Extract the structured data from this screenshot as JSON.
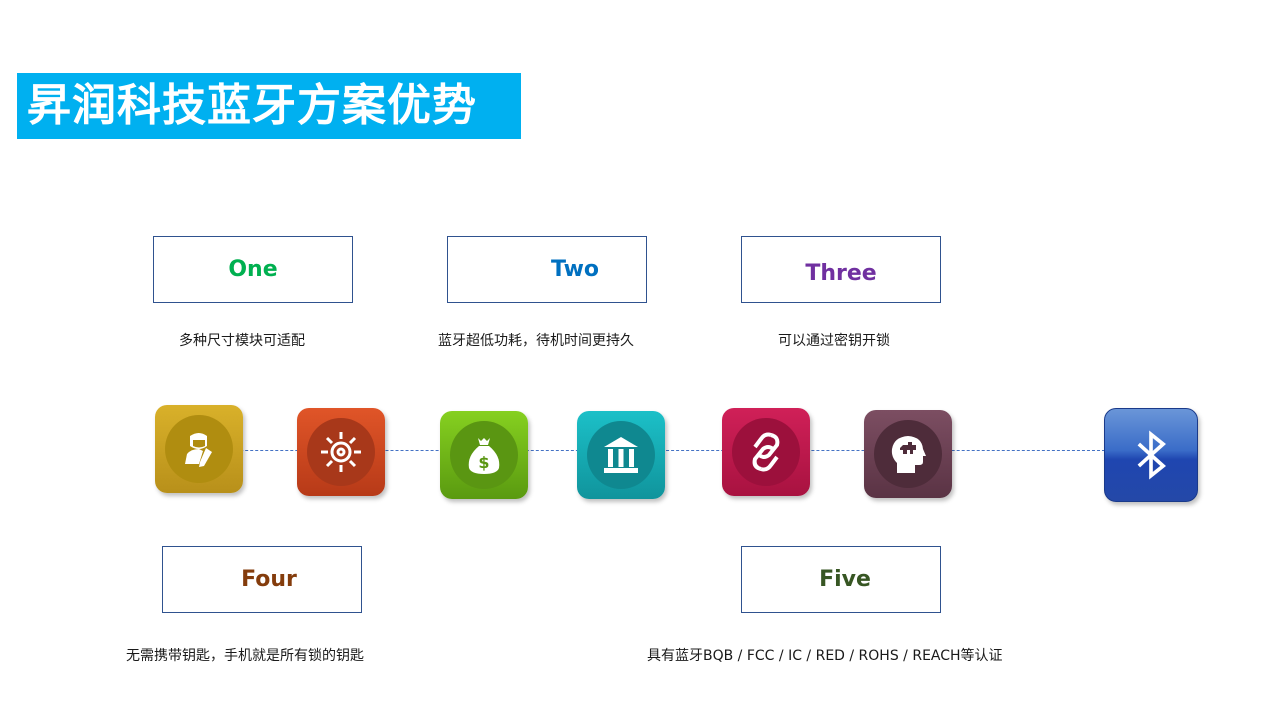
{
  "title": "昇润科技蓝牙方案优势",
  "colors": {
    "title_bg": "#00b0f0",
    "box_border": "#2f528f",
    "connector": "#4472c4"
  },
  "features": [
    {
      "label": "One",
      "color": "#00b050",
      "description": "多种尺寸模块可适配"
    },
    {
      "label": "Two",
      "color": "#0070c0",
      "description": "蓝牙超低功耗，待机时间更持久"
    },
    {
      "label": "Three",
      "color": "#7030a0",
      "description": "可以通过密钥开锁"
    },
    {
      "label": "Four",
      "color": "#843c0c",
      "description": "无需携带钥匙，手机就是所有锁的钥匙"
    },
    {
      "label": "Five",
      "color": "#375623",
      "description": "具有蓝牙BQB / FCC / IC / RED / ROHS / REACH等认证"
    }
  ],
  "icons": [
    {
      "name": "person-edit-icon",
      "color": "#c9a11a"
    },
    {
      "name": "ship-wheel-icon",
      "color": "#d04a20"
    },
    {
      "name": "money-bag-icon",
      "color": "#6eb51a"
    },
    {
      "name": "bank-icon",
      "color": "#17a6b0"
    },
    {
      "name": "link-icon",
      "color": "#b8174a"
    },
    {
      "name": "head-puzzle-icon",
      "color": "#6a3f52"
    },
    {
      "name": "bluetooth-icon",
      "color": "#2350b8"
    }
  ]
}
